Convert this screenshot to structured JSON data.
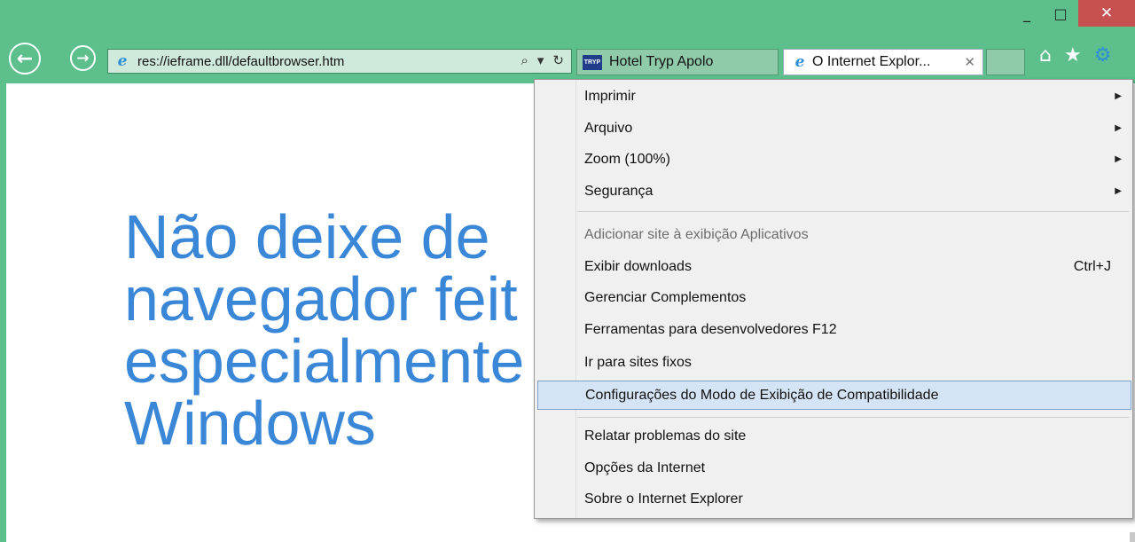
{
  "window": {
    "minimize": "_",
    "maximize": "□",
    "close": "✕"
  },
  "nav": {
    "back_glyph": "←",
    "forward_glyph": "→"
  },
  "address": {
    "url": "res://ieframe.dll/defaultbrowser.htm",
    "search_glyph": "⌕",
    "dropdown_glyph": "▾",
    "refresh_glyph": "↻"
  },
  "tabs": [
    {
      "label": "Hotel Tryp Apolo",
      "favicon_text": "TRYP"
    },
    {
      "label": "O Internet Explor...",
      "close_glyph": "✕"
    }
  ],
  "tools": {
    "home": "⌂",
    "favorites": "★",
    "settings": "⚙"
  },
  "page": {
    "headline_lines": [
      "Não deixe de",
      "navegador feit",
      "especialmente",
      "Windows"
    ]
  },
  "menu": {
    "items": [
      {
        "label": "Imprimir",
        "submenu": true
      },
      {
        "label": "Arquivo",
        "submenu": true
      },
      {
        "label": "Zoom (100%)",
        "submenu": true
      },
      {
        "label": "Segurança",
        "submenu": true
      },
      {
        "label": "Adicionar site à exibição Aplicativos",
        "disabled": true
      },
      {
        "label": "Exibir downloads",
        "shortcut": "Ctrl+J"
      },
      {
        "label": "Gerenciar Complementos"
      },
      {
        "label": "Ferramentas para desenvolvedores F12"
      },
      {
        "label": "Ir para sites fixos"
      },
      {
        "label": "Configurações do Modo de Exibição de Compatibilidade",
        "highlighted": true
      },
      {
        "label": "Relatar problemas do site"
      },
      {
        "label": "Opções da Internet"
      },
      {
        "label": "Sobre o Internet Explorer"
      }
    ],
    "arrow_glyph": "▶"
  },
  "colors": {
    "frame": "#5dbf8c",
    "headline": "#3a87d8",
    "menu_bg": "#f0f0f0",
    "menu_highlight": "#d5e4f4"
  }
}
